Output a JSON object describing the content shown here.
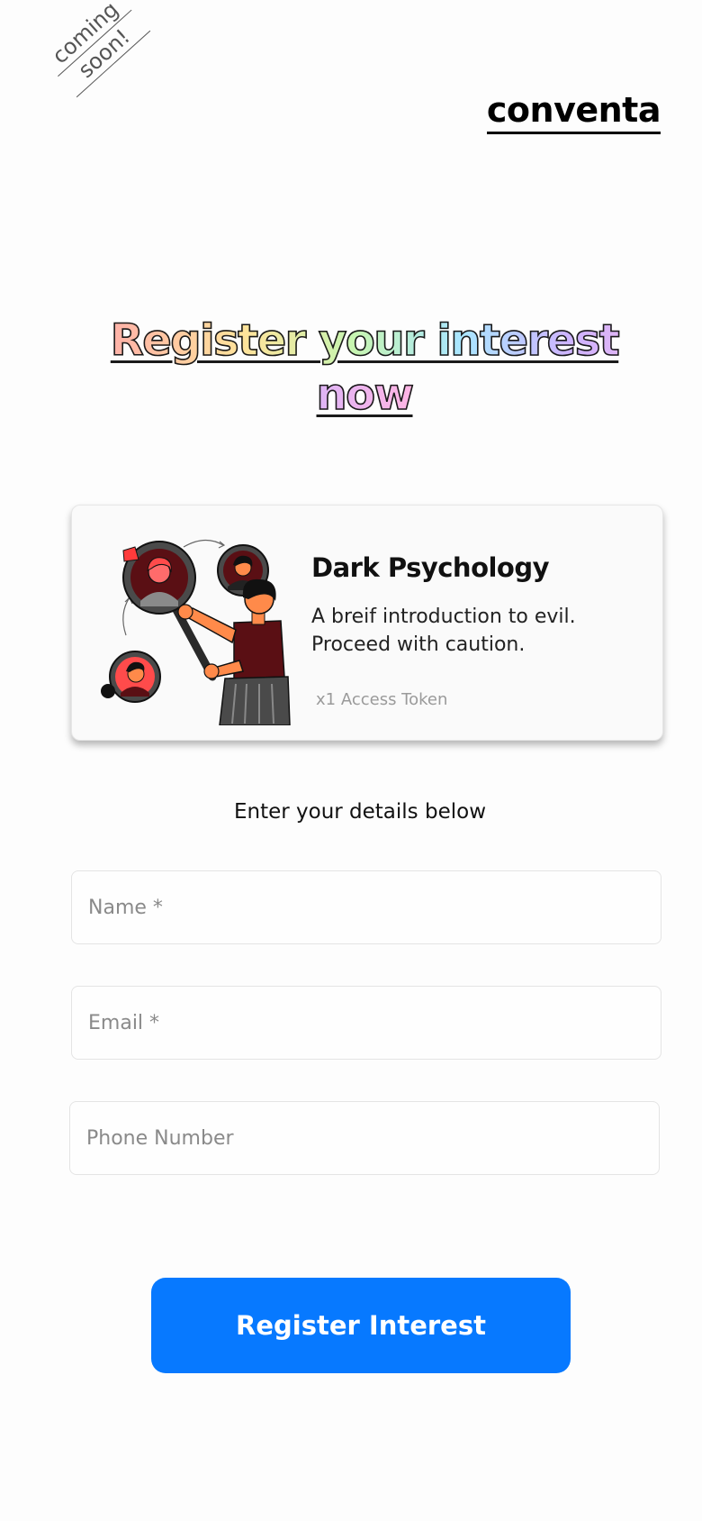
{
  "header": {
    "badge_line1": "coming",
    "badge_line2": "soon!",
    "brand": "conventa"
  },
  "hero": {
    "headline": "Register your interest now"
  },
  "card": {
    "title": "Dark Psychology",
    "desc_line1": "A breif introduction to evil.",
    "desc_line2": "Proceed with caution.",
    "token": "x1 Access Token",
    "illustration_icon": "person-holding-magnifier-illustration"
  },
  "form": {
    "subtitle": "Enter your details below",
    "name_placeholder": "Name *",
    "email_placeholder": "Email *",
    "phone_placeholder": "Phone Number",
    "submit_label": "Register Interest"
  },
  "colors": {
    "primary": "#0779ff",
    "background": "#fdfdfd",
    "card_bg": "#fafafa"
  }
}
